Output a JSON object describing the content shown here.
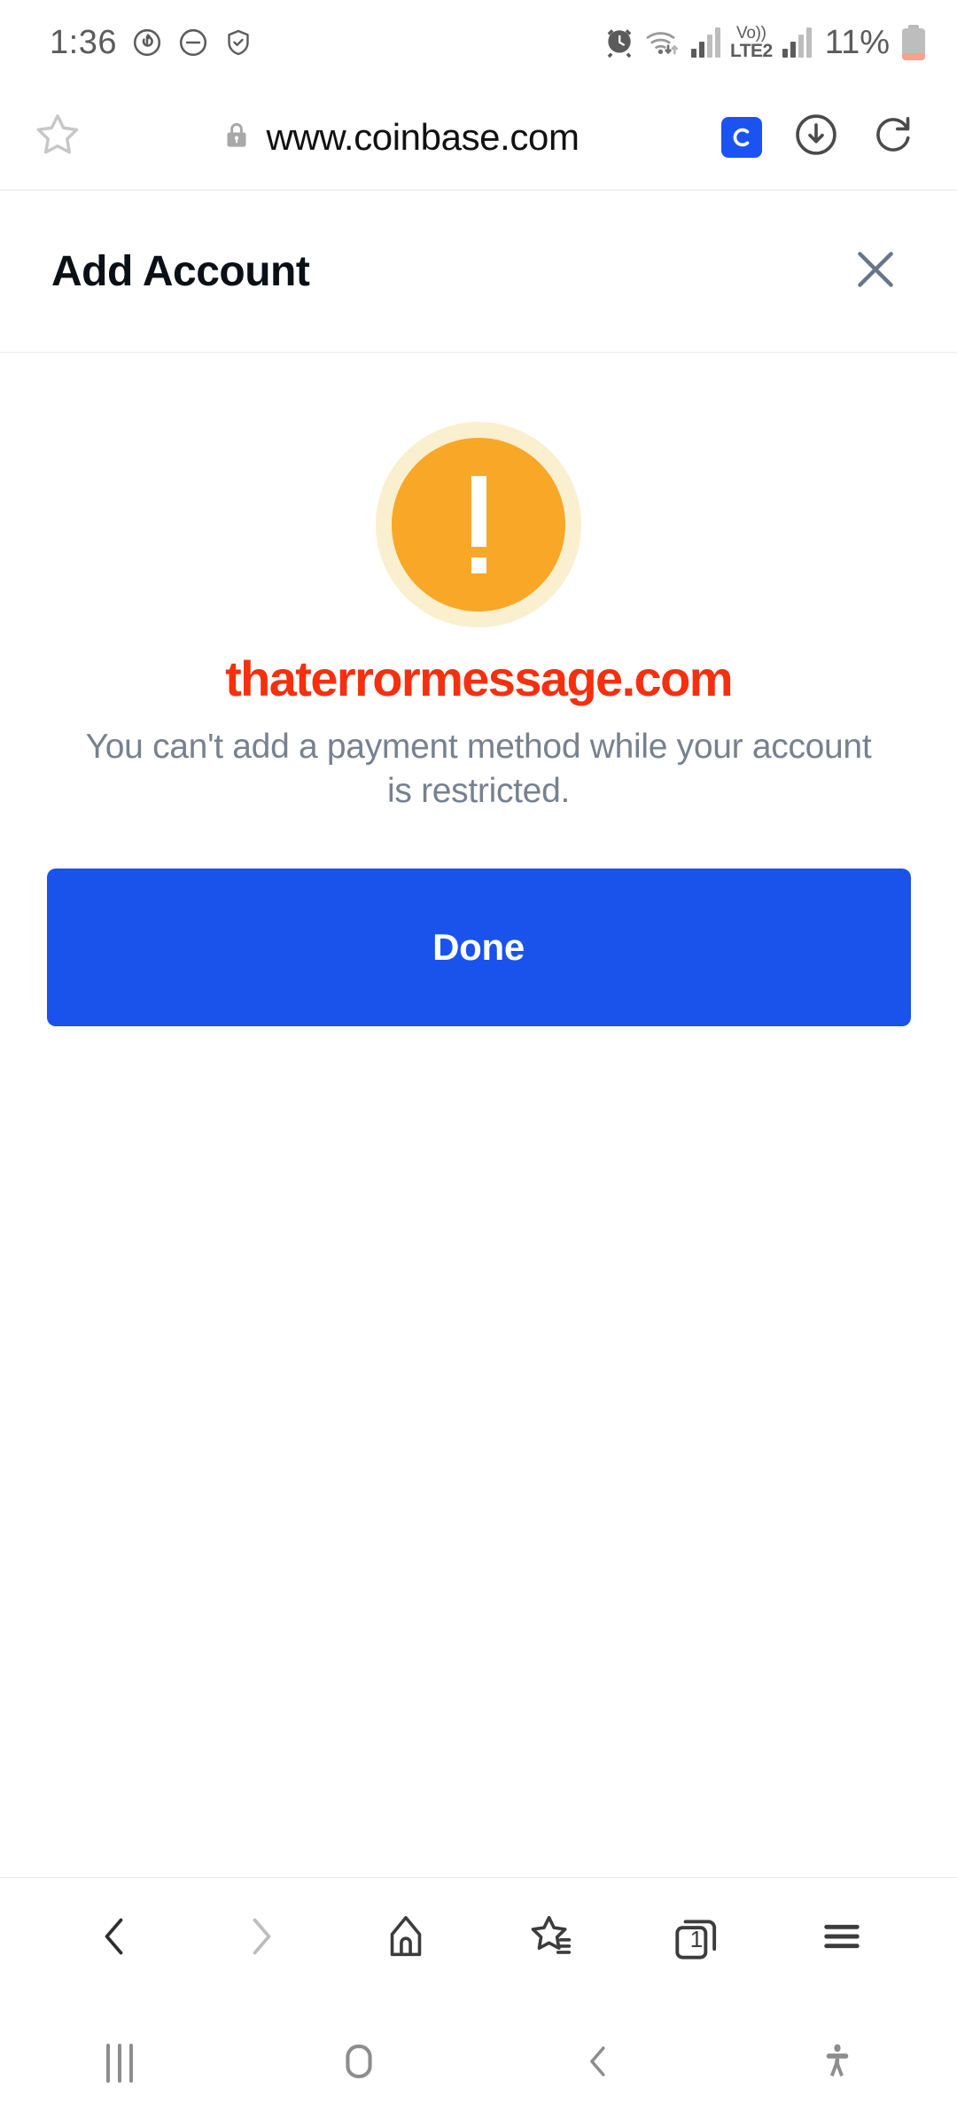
{
  "status_bar": {
    "time": "1:36",
    "battery_percent": "11%",
    "network_label_top": "Vo))",
    "network_label_bottom": "LTE2",
    "icons": [
      "sync-icon",
      "do-not-disturb-icon",
      "shield-check-icon",
      "alarm-icon",
      "wifi-icon",
      "signal-bars-icon",
      "volte-icon",
      "signal-bars-2-icon",
      "battery-icon"
    ]
  },
  "browser": {
    "url": "www.coinbase.com",
    "secure_icon": "lock-icon",
    "bookmark_icon": "star-outline-icon",
    "site_badge": "C",
    "badge_color": "#1a53f0",
    "download_icon": "download-circle-icon",
    "reload_icon": "reload-icon",
    "bottom_bar": {
      "back": "back-chevron-icon",
      "forward": "forward-chevron-icon",
      "home": "home-icon",
      "bookmarks": "bookmarks-star-icon",
      "tabs_count": "1",
      "menu": "hamburger-menu-icon"
    }
  },
  "sheet": {
    "title": "Add Account",
    "close_icon": "close-x-icon",
    "close_color": "#66758a"
  },
  "error": {
    "icon": "warning-exclamation-icon",
    "icon_color": "#f9a726",
    "icon_ring_color": "#faf0d0",
    "watermark": "thaterrormessage.com",
    "watermark_color": "#f4300f",
    "message": "You can't add a payment method while your account is restricted.",
    "message_color": "#77818f"
  },
  "actions": {
    "done_label": "Done",
    "done_color": "#1a53ec"
  },
  "android_nav": {
    "recents": "recent-apps-icon",
    "home": "home-circle-icon",
    "back": "back-icon",
    "accessibility": "accessibility-icon"
  }
}
